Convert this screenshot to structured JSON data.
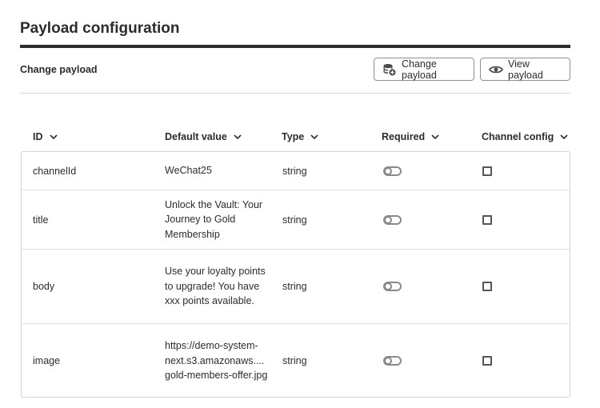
{
  "page": {
    "title": "Payload configuration",
    "subtitle": "Change payload"
  },
  "toolbar": {
    "change_label": "Change payload",
    "change_icon": "database-add-icon",
    "view_label": "View payload",
    "view_icon": "eye-icon"
  },
  "table": {
    "columns": [
      {
        "label": "ID"
      },
      {
        "label": "Default value"
      },
      {
        "label": "Type"
      },
      {
        "label": "Required"
      },
      {
        "label": "Channel config"
      }
    ],
    "rows": [
      {
        "id": "channelId",
        "default": "WeChat25",
        "type": "string",
        "required": false,
        "channel_config": false
      },
      {
        "id": "title",
        "default": "Unlock the Vault: Your Journey to Gold Membership",
        "type": "string",
        "required": false,
        "channel_config": false
      },
      {
        "id": "body",
        "default": "Use your loyalty points to upgrade! You have xxx points available.",
        "type": "string",
        "required": false,
        "channel_config": false
      },
      {
        "id": "image",
        "default": "https://demo-system-next.s3.amazonaws.... gold-members-offer.jpg",
        "type": "string",
        "required": false,
        "channel_config": false
      }
    ]
  }
}
